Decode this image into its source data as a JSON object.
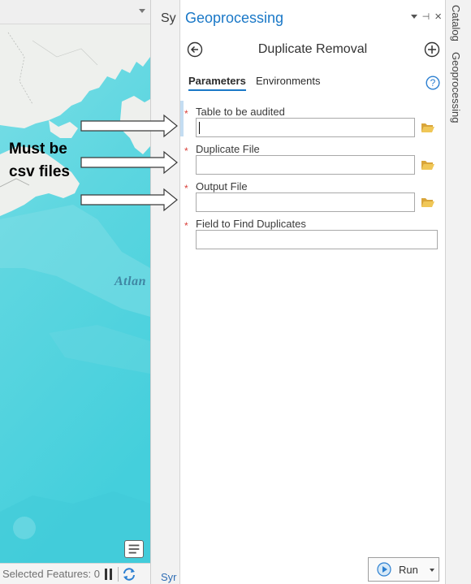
{
  "map_view": {
    "ocean_label": "Atlan",
    "status": {
      "selected_features": "Selected Features: 0"
    },
    "icons": [
      "pause-icon",
      "refresh-icon",
      "legend-icon"
    ]
  },
  "symbology_strip": {
    "top_label": "Sy",
    "bottom_label": "Syr"
  },
  "geoprocessing": {
    "pane_title": "Geoprocessing",
    "tool_name": "Duplicate Removal",
    "tabs": [
      {
        "label": "Parameters",
        "active": true
      },
      {
        "label": "Environments",
        "active": false
      }
    ],
    "parameters": [
      {
        "label": "Table to be audited",
        "required": "*",
        "value": "",
        "has_browse": true
      },
      {
        "label": "Duplicate File",
        "required": "*",
        "value": "",
        "has_browse": true
      },
      {
        "label": "Output File",
        "required": "*",
        "value": "",
        "has_browse": true
      },
      {
        "label": "Field to Find Duplicates",
        "required": "*",
        "value": "",
        "has_browse": false
      }
    ],
    "run_button": {
      "label": "Run"
    }
  },
  "right_dock": {
    "tabs": [
      "Catalog",
      "Geoprocessing"
    ]
  },
  "annotation": {
    "line1": "Must be",
    "line2": "csv files"
  },
  "colors": {
    "accent": "#1a78c7",
    "required": "#d9403a",
    "folder": "#e9b949",
    "ocean": "#4fd0db"
  }
}
